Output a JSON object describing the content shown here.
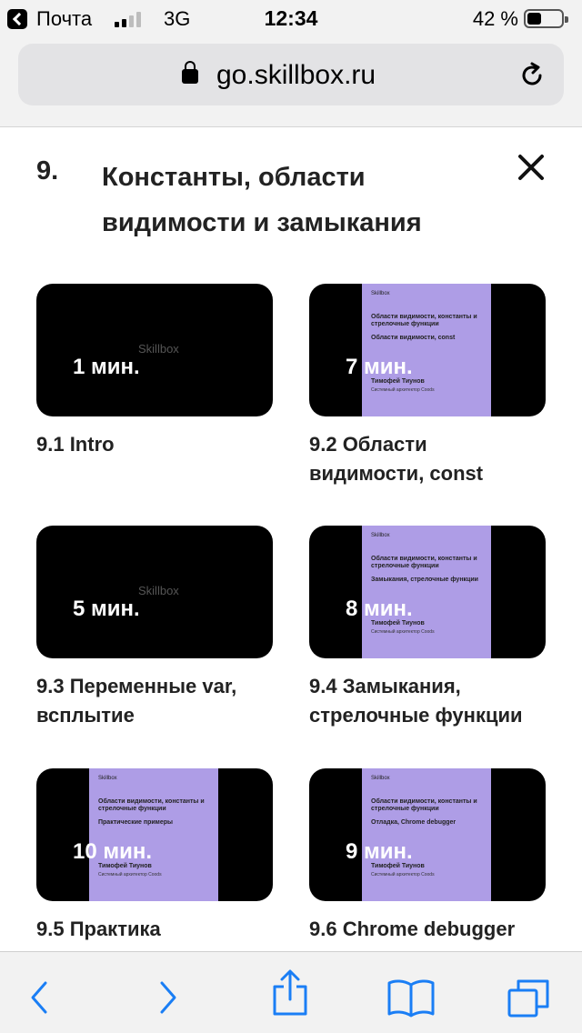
{
  "status_bar": {
    "carrier": "Почта",
    "network": "3G",
    "time": "12:34",
    "battery_percent": "42 %",
    "battery_level": 0.42
  },
  "browser": {
    "address": "go.skillbox.ru",
    "icons": [
      "lock-icon",
      "reload-icon"
    ]
  },
  "section": {
    "number": "9.",
    "title": "Константы, области видимости и замыкания",
    "close_icon": "close-icon"
  },
  "lessons": [
    {
      "title": "9.1 Intro",
      "duration": "1 мин.",
      "thumb_style": "logo",
      "thumb_logo": "Skillbox"
    },
    {
      "title": "9.2 Области видимости, const",
      "duration": "7 мин.",
      "thumb_style": "slide",
      "slide": {
        "brand": "Skillbox",
        "heading": "Области видимости, константы и стрелочные функции",
        "subtitle": "Области видимости, const",
        "author": "Тимофей Тиунов",
        "role": "Системный архитектор Coods"
      }
    },
    {
      "title": "9.3 Переменные var, всплытие",
      "duration": "5 мин.",
      "thumb_style": "logo",
      "thumb_logo": "Skillbox"
    },
    {
      "title": "9.4 Замыкания, стрелочные функции",
      "duration": "8 мин.",
      "thumb_style": "slide",
      "slide": {
        "brand": "Skillbox",
        "heading": "Области видимости, константы и стрелочные функции",
        "subtitle": "Замыкания, стрелочные функции",
        "author": "Тимофей Тиунов",
        "role": "Системный архитектор Coods"
      }
    },
    {
      "title": "9.5 Практика",
      "duration": "10 мин.",
      "thumb_style": "slide",
      "slide": {
        "brand": "Skillbox",
        "heading": "Области видимости, константы и стрелочные функции",
        "subtitle": "Практические примеры",
        "author": "Тимофей Тиунов",
        "role": "Системный архитектор Coods"
      }
    },
    {
      "title": "9.6 Chrome debugger",
      "duration": "9 мин.",
      "thumb_style": "slide",
      "slide": {
        "brand": "Skillbox",
        "heading": "Области видимости, константы и стрелочные функции",
        "subtitle": "Отладка, Chrome debugger",
        "author": "Тимофей Тиунов",
        "role": "Системный архитектор Coods"
      }
    }
  ],
  "toolbar": {
    "icons": [
      "back-arrow-icon",
      "forward-arrow-icon",
      "share-icon",
      "bookmarks-icon",
      "tabs-icon"
    ]
  },
  "colors": {
    "accent": "#1a7ef5",
    "slide_background": "#ae9de6",
    "thumbnail_background": "#000000",
    "chrome_background": "#f2f2f2"
  }
}
